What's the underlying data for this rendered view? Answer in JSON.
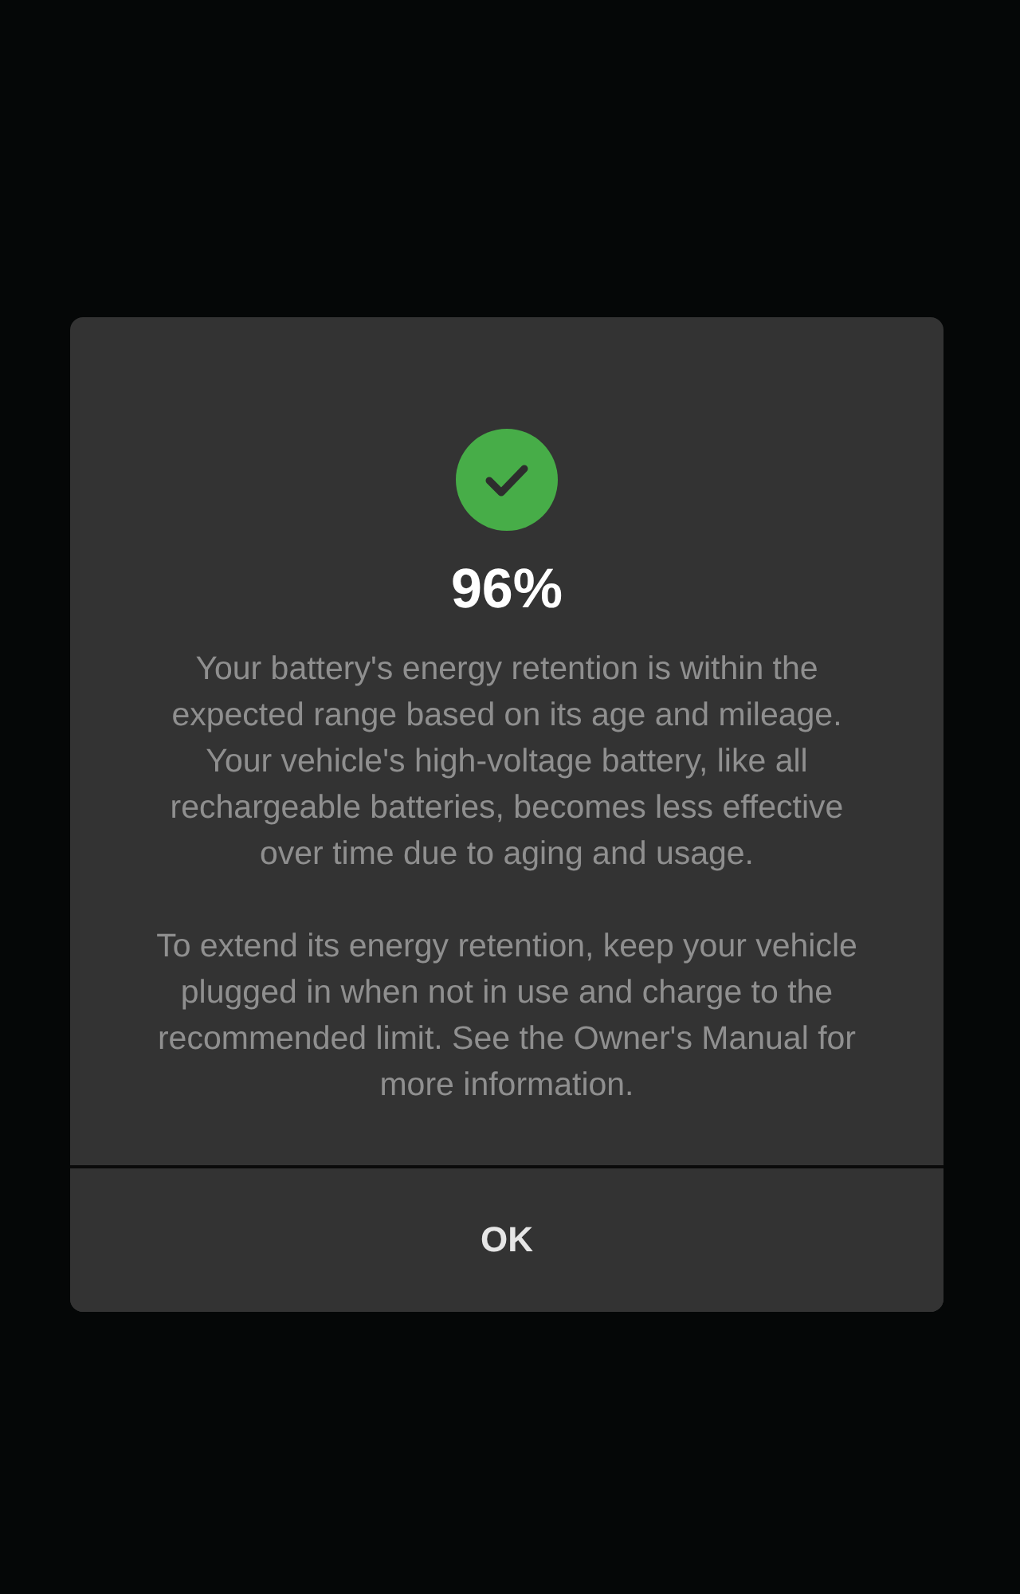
{
  "dialog": {
    "passed": true,
    "value": "96%",
    "paragraphs": [
      "Your battery's energy retention is within the expected range based on its age and mileage. Your vehicle's high-voltage battery, like all rechargeable batteries, becomes less effective over time due to aging and usage.",
      "To extend its energy retention, keep your vehicle plugged in when not in use and charge to the recommended limit. See the Owner's Manual for more information."
    ],
    "button": "OK"
  }
}
